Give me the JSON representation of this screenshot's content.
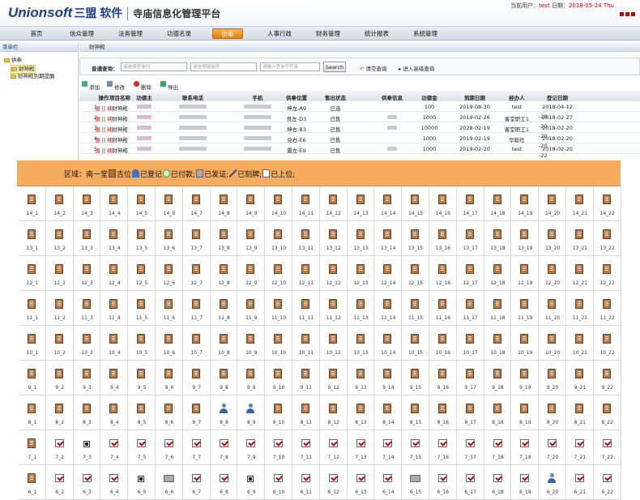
{
  "header": {
    "brand": "Unionsoft",
    "brand_cn": "三盟 软件",
    "system": "寺庙信息化管理平台",
    "user_label": "当前用户：",
    "user": "test",
    "date_label": "日期：",
    "date": "2018-05-24 Thu"
  },
  "nav": [
    "首页",
    "信众管理",
    "法务管理",
    "功德名录",
    "供奉",
    "人事行政",
    "财务管理",
    "统计报表",
    "系统管理"
  ],
  "nav_active": 4,
  "sidebar": {
    "title": "菜单栏",
    "root": "供奉",
    "items": [
      "财神殿",
      "财神殿到期提醒"
    ]
  },
  "main_title": "财神殿",
  "search": {
    "label": "普通查询：",
    "p1": "请选择查询列",
    "p2": "请选择链接符",
    "p3": "请输入查询字符串",
    "button": "Search",
    "clear": "清空查询",
    "advanced": "进入高级查询"
  },
  "toolbar": [
    "添加",
    "修改",
    "删除",
    "导出"
  ],
  "table": {
    "headers": [
      "操作",
      "项目名称",
      "功德主",
      "联系电话",
      "手机",
      "供奉位置",
      "售出状态",
      "供奉信息",
      "功德金",
      "到期日期",
      "经办人",
      "登记日期"
    ],
    "rows": [
      {
        "no": "1",
        "op": "退 || 续",
        "name": "财神殿",
        "pos": "坤左-A9",
        "status": "已选",
        "amount": "100",
        "due": "2019-08-30",
        "agent": "test",
        "reg": "2018-04-12"
      },
      {
        "no": "2",
        "op": "退 || 续",
        "name": "财神殿",
        "pos": "艮左-D3",
        "status": "已售",
        "amount": "1000",
        "due": "2019-02-26",
        "agent": "客堂职工1",
        "reg": "2018-02-27"
      },
      {
        "no": "3",
        "op": "退 || 续",
        "name": "财神殿",
        "pos": "坤右-B3",
        "status": "已售",
        "amount": "10000",
        "due": "2028-02-19",
        "agent": "客堂职工1",
        "reg": "2018-02-20"
      },
      {
        "no": "4",
        "op": "退 || 续",
        "name": "财神殿",
        "pos": "兑右-E6",
        "status": "已售",
        "amount": "1000",
        "due": "2019-02-19",
        "agent": "华聪社",
        "reg": "2018-02-20"
      },
      {
        "no": "5",
        "op": "退 || 续",
        "name": "财神殿",
        "pos": "震左-E9",
        "status": "已售",
        "amount": "1000",
        "due": "2019-02-20",
        "agent": "test",
        "reg": "2018-02-20"
      }
    ],
    "extra_reg": [
      "-20",
      "-20",
      "-20",
      "-20",
      "-22"
    ]
  },
  "overlay": {
    "prefix": "区域：南一堂",
    "legend": [
      {
        "icon": "tablet",
        "text": "吉位"
      },
      {
        "icon": "person",
        "text": "已登记"
      },
      {
        "icon": "paid",
        "text": "已付款;"
      },
      {
        "icon": "print",
        "text": "已发证;"
      },
      {
        "icon": "pen",
        "text": "已刻牌;"
      },
      {
        "icon": "check",
        "text": "已上位;"
      }
    ]
  },
  "grid": {
    "rows": [
      14,
      13,
      12,
      11,
      10,
      9,
      8,
      7,
      6
    ],
    "cols": 22,
    "special": {
      "8_8": "person",
      "8_9": "person",
      "7_2": "check",
      "7_3": "stamp",
      "7_4": "check",
      "7_5": "check",
      "7_6": "check",
      "7_7": "check",
      "7_8": "check",
      "7_9": "check",
      "7_10": "check",
      "7_11": "check",
      "7_12": "check",
      "7_13": "check",
      "7_14": "check",
      "7_15": "check",
      "7_16": "check",
      "7_17": "check",
      "7_18": "check",
      "7_19": "check",
      "7_20": "check",
      "7_21": "check",
      "7_22": "check",
      "6_2": "check",
      "6_3": "check",
      "6_4": "check",
      "6_5": "stamp",
      "6_6": "print",
      "6_7": "check",
      "6_8": "check",
      "6_9": "stamp",
      "6_10": "check",
      "6_11": "check",
      "6_12": "check",
      "6_13": "check",
      "6_14": "check",
      "6_15": "print",
      "6_16": "check",
      "6_17": "check",
      "6_18": "check",
      "6_19": "check",
      "6_20": "person",
      "6_21": "check",
      "6_22": "check"
    }
  }
}
